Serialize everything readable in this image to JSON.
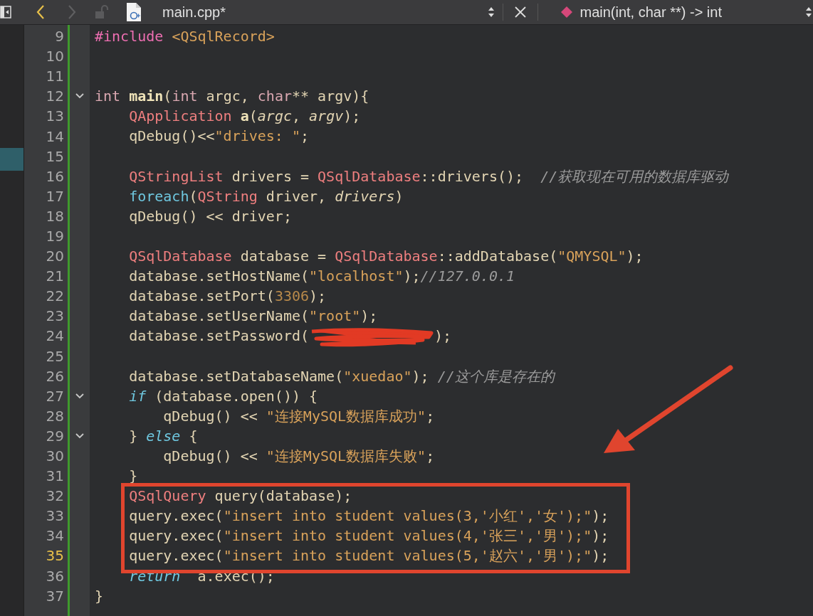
{
  "toolbar": {
    "back_enabled": true,
    "forward_enabled": false,
    "file_name": "main.cpp*",
    "symbol": "main(int, char **) -> int"
  },
  "lines": [
    {
      "n": "9",
      "fold": false,
      "current": false,
      "boxed": false,
      "tokens": [
        {
          "t": "#include ",
          "kind": "pre"
        },
        {
          "t": "<QSqlRecord>",
          "kind": "str"
        }
      ]
    },
    {
      "n": "10",
      "fold": false,
      "current": false,
      "boxed": false
    },
    {
      "n": "11",
      "fold": false,
      "current": false,
      "boxed": false
    },
    {
      "n": "12",
      "fold": true,
      "current": false,
      "boxed": false,
      "tokens": [
        {
          "t": "int ",
          "kind": "kw"
        },
        {
          "t": "main",
          "kind": "fn"
        },
        {
          "t": "(",
          "kind": "p"
        },
        {
          "t": "int",
          "kind": "kw"
        },
        {
          "t": " argc, ",
          "kind": "p"
        },
        {
          "t": "char",
          "kind": "kw"
        },
        {
          "t": "** argv){",
          "kind": "p"
        }
      ]
    },
    {
      "n": "13",
      "fold": false,
      "current": false,
      "boxed": false,
      "tokens": [
        {
          "t": "    QApplication ",
          "kind": "type"
        },
        {
          "t": "a",
          "kind": "fn"
        },
        {
          "t": "(",
          "kind": "p"
        },
        {
          "t": "argc",
          "kind": "param"
        },
        {
          "t": ", ",
          "kind": "p"
        },
        {
          "t": "argv",
          "kind": "param"
        },
        {
          "t": ");",
          "kind": "p"
        }
      ]
    },
    {
      "n": "14",
      "fold": false,
      "current": false,
      "boxed": false,
      "tokens": [
        {
          "t": "    qDebug()<<",
          "kind": "p"
        },
        {
          "t": "\"drives: \"",
          "kind": "str"
        },
        {
          "t": ";",
          "kind": "p"
        }
      ]
    },
    {
      "n": "15",
      "fold": false,
      "current": false,
      "boxed": false
    },
    {
      "n": "16",
      "fold": false,
      "current": false,
      "boxed": false,
      "tokens": [
        {
          "t": "    QStringList",
          "kind": "type"
        },
        {
          "t": " drivers = ",
          "kind": "p"
        },
        {
          "t": "QSqlDatabase",
          "kind": "type"
        },
        {
          "t": "::drivers();  ",
          "kind": "p"
        },
        {
          "t": "//获取现在可用的数据库驱动",
          "kind": "cmt"
        }
      ]
    },
    {
      "n": "17",
      "fold": false,
      "current": false,
      "boxed": false,
      "tokens": [
        {
          "t": "    foreach",
          "kind": "macro"
        },
        {
          "t": "(",
          "kind": "p"
        },
        {
          "t": "QString",
          "kind": "type"
        },
        {
          "t": " driver, ",
          "kind": "p"
        },
        {
          "t": "drivers",
          "kind": "param"
        },
        {
          "t": ")",
          "kind": "p"
        }
      ]
    },
    {
      "n": "18",
      "fold": false,
      "current": false,
      "boxed": false,
      "tokens": [
        {
          "t": "    qDebug() << driver;",
          "kind": "p"
        }
      ]
    },
    {
      "n": "19",
      "fold": false,
      "current": false,
      "boxed": false
    },
    {
      "n": "20",
      "fold": false,
      "current": false,
      "boxed": false,
      "tokens": [
        {
          "t": "    QSqlDatabase",
          "kind": "type"
        },
        {
          "t": " database = ",
          "kind": "p"
        },
        {
          "t": "QSqlDatabase",
          "kind": "type"
        },
        {
          "t": "::addDatabase(",
          "kind": "p"
        },
        {
          "t": "\"QMYSQL\"",
          "kind": "str"
        },
        {
          "t": ");",
          "kind": "p"
        }
      ]
    },
    {
      "n": "21",
      "fold": false,
      "current": false,
      "boxed": false,
      "tokens": [
        {
          "t": "    database.setHostName(",
          "kind": "p"
        },
        {
          "t": "\"localhost\"",
          "kind": "str"
        },
        {
          "t": ");",
          "kind": "p"
        },
        {
          "t": "//127.0.0.1",
          "kind": "cmt"
        }
      ]
    },
    {
      "n": "22",
      "fold": false,
      "current": false,
      "boxed": false,
      "tokens": [
        {
          "t": "    database.setPort(",
          "kind": "p"
        },
        {
          "t": "3306",
          "kind": "num"
        },
        {
          "t": ");",
          "kind": "p"
        }
      ]
    },
    {
      "n": "23",
      "fold": false,
      "current": false,
      "boxed": false,
      "tokens": [
        {
          "t": "    database.setUserName(",
          "kind": "p"
        },
        {
          "t": "\"root\"",
          "kind": "str"
        },
        {
          "t": ");",
          "kind": "p"
        }
      ]
    },
    {
      "n": "24",
      "fold": false,
      "current": false,
      "boxed": false,
      "tokens": [
        {
          "t": "    database.setPassword(",
          "kind": "p"
        },
        {
          "kind": "redaction"
        },
        {
          "t": ");",
          "kind": "p"
        }
      ]
    },
    {
      "n": "25",
      "fold": false,
      "current": false,
      "boxed": false
    },
    {
      "n": "26",
      "fold": false,
      "current": false,
      "boxed": false,
      "tokens": [
        {
          "t": "    database.setDatabaseName(",
          "kind": "p"
        },
        {
          "t": "\"xuedao\"",
          "kind": "str"
        },
        {
          "t": "); ",
          "kind": "p"
        },
        {
          "t": "//这个库是存在的",
          "kind": "cmt"
        }
      ]
    },
    {
      "n": "27",
      "fold": true,
      "current": false,
      "boxed": false,
      "tokens": [
        {
          "t": "    if",
          "kind": "ctl"
        },
        {
          "t": " (database.open()) {",
          "kind": "p"
        }
      ]
    },
    {
      "n": "28",
      "fold": false,
      "current": false,
      "boxed": false,
      "tokens": [
        {
          "t": "        qDebug() << ",
          "kind": "p"
        },
        {
          "t": "\"连接MySQL数据库成功\"",
          "kind": "str"
        },
        {
          "t": ";",
          "kind": "p"
        }
      ]
    },
    {
      "n": "29",
      "fold": true,
      "current": false,
      "boxed": false,
      "tokens": [
        {
          "t": "    } ",
          "kind": "p"
        },
        {
          "t": "else",
          "kind": "ctl"
        },
        {
          "t": " {",
          "kind": "p"
        }
      ]
    },
    {
      "n": "30",
      "fold": false,
      "current": false,
      "boxed": false,
      "tokens": [
        {
          "t": "        qDebug() << ",
          "kind": "p"
        },
        {
          "t": "\"连接MySQL数据库失败\"",
          "kind": "str"
        },
        {
          "t": ";",
          "kind": "p"
        }
      ]
    },
    {
      "n": "31",
      "fold": false,
      "current": false,
      "boxed": false,
      "tokens": [
        {
          "t": "    }",
          "kind": "p"
        }
      ]
    },
    {
      "n": "32",
      "fold": false,
      "current": false,
      "boxed": true,
      "tokens": [
        {
          "t": "    QSqlQuery",
          "kind": "type"
        },
        {
          "t": " query(database);",
          "kind": "p"
        }
      ]
    },
    {
      "n": "33",
      "fold": false,
      "current": false,
      "boxed": true,
      "tokens": [
        {
          "t": "    query.exec(",
          "kind": "p"
        },
        {
          "t": "\"insert into student values(3,'小红','女');\"",
          "kind": "str"
        },
        {
          "t": ");",
          "kind": "p"
        }
      ]
    },
    {
      "n": "34",
      "fold": false,
      "current": false,
      "boxed": true,
      "tokens": [
        {
          "t": "    query.exec(",
          "kind": "p"
        },
        {
          "t": "\"insert into student values(4,'张三','男');\"",
          "kind": "str"
        },
        {
          "t": ");",
          "kind": "p"
        }
      ]
    },
    {
      "n": "35",
      "fold": false,
      "current": true,
      "boxed": true,
      "tokens": [
        {
          "t": "    query.exec(",
          "kind": "p"
        },
        {
          "t": "\"insert into student values(5,'赵六','男');\"",
          "kind": "str"
        },
        {
          "t": ");",
          "kind": "p"
        }
      ]
    },
    {
      "n": "36",
      "fold": false,
      "current": false,
      "boxed": false,
      "tokens": [
        {
          "t": "    return",
          "kind": "ctl"
        },
        {
          "t": "  a.exec();",
          "kind": "p"
        }
      ]
    },
    {
      "n": "37",
      "fold": false,
      "current": false,
      "boxed": false,
      "tokens": [
        {
          "t": "}",
          "kind": "p"
        }
      ]
    }
  ],
  "annotations": [
    {
      "kind": "arrow"
    }
  ]
}
